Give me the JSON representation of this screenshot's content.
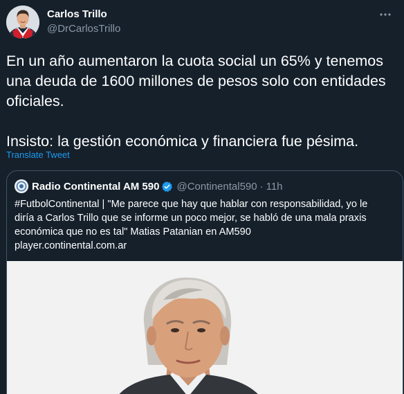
{
  "author": {
    "name": "Carlos Trillo",
    "handle": "@DrCarlosTrillo"
  },
  "tweet": {
    "text": "En un año aumentaron la cuota social un 65% y tenemos una deuda de 1600 millones de pesos solo con entidades oficiales.\n\nInsisto: la gestión económica y financiera fue pésima.",
    "translate_label": "Translate Tweet"
  },
  "quoted": {
    "name": "Radio Continental AM 590",
    "handle": "@Continental590",
    "separator": "·",
    "time": "11h",
    "text_line1": "#FutbolContinental | \"Me parece que hay que hablar con responsabilidad, yo le",
    "text_line2": "diría a Carlos Trillo que se informe un poco mejor, se habló de una mala praxis",
    "text_line3": "económica que no es tal\" Matias Patanian en AM590",
    "link": "player.continental.com.ar"
  },
  "colors": {
    "background": "#15202b",
    "text": "#ffffff",
    "secondary_text": "#8b98a5",
    "link": "#1d9bf0",
    "border": "#425364",
    "verified": "#1d9bf0"
  },
  "icons": {
    "more": "more-horizontal-icon",
    "verified": "verified-badge-icon"
  }
}
